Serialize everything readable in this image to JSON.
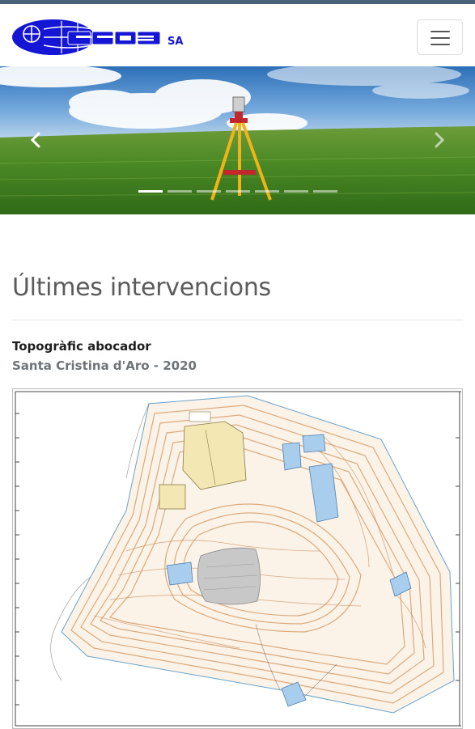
{
  "brand": {
    "logo_text": "GEO3",
    "logo_suffix": "SA",
    "brand_color": "#1515d6"
  },
  "navbar": {
    "menu_icon": "hamburger-menu-icon"
  },
  "carousel": {
    "slide_count": 7,
    "active_slide": 1,
    "prev_icon": "chevron-left-icon",
    "next_icon": "chevron-right-icon"
  },
  "section": {
    "title": "Últimes intervencions"
  },
  "intervention": {
    "title": "Topogràfic abocador",
    "subtitle": "Santa Cristina d'Aro - 2020"
  },
  "colors": {
    "topbar": "#4a6178",
    "title_text": "#5b5b5b",
    "subtitle_text": "#6f7479"
  }
}
